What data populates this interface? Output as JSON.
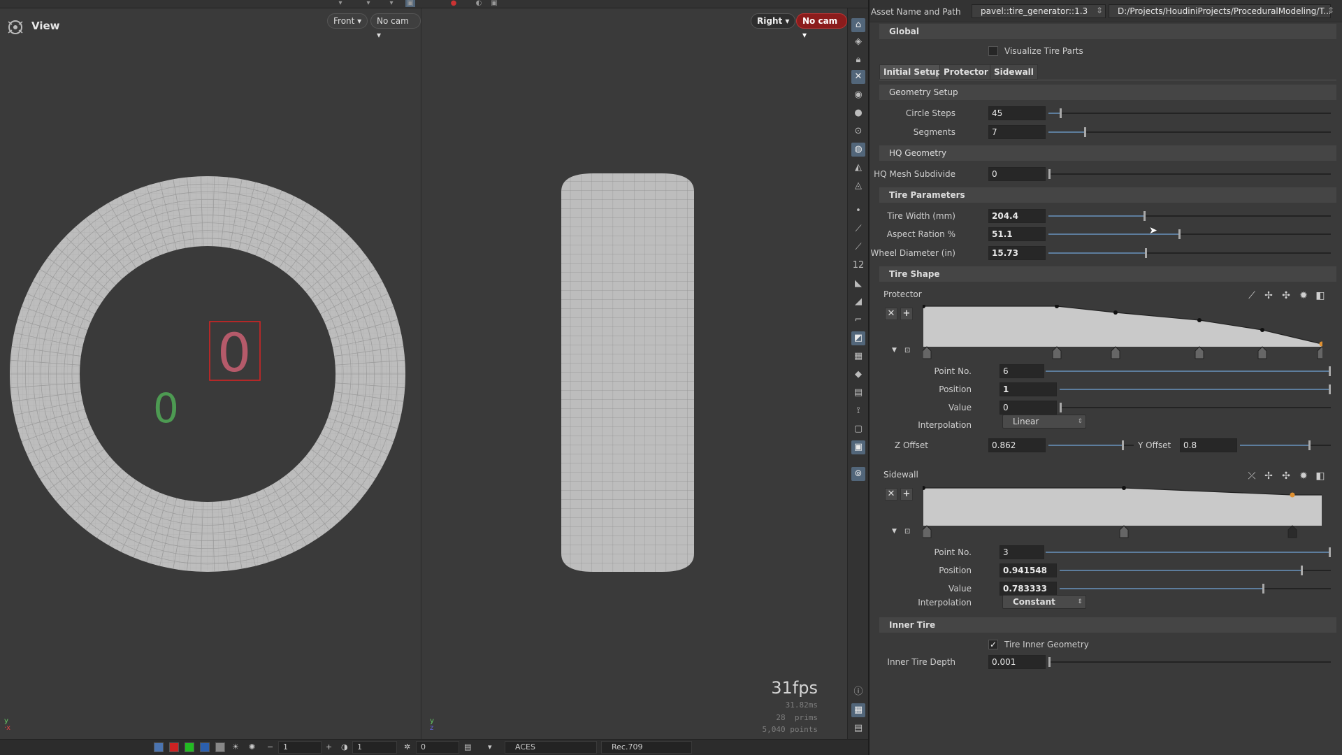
{
  "viewport": {
    "title": "View",
    "left_view": {
      "view_label": "Front",
      "cam_label": "No cam"
    },
    "right_view": {
      "view_label": "Right",
      "cam_label": "No cam"
    },
    "fps": "31fps",
    "frame_time": "31.82ms",
    "prims": "28  prims",
    "points": "5,040 points",
    "left_axis": "y\nx",
    "right_axis": "y\nz",
    "number_red": "0",
    "number_green": "0"
  },
  "bottombar": {
    "field1": "1",
    "field2": "1",
    "field3": "0",
    "colorspace": "ACES",
    "display": "Rec.709"
  },
  "panel": {
    "asset_label": "Asset Name and Path",
    "asset_name": "pavel::tire_generator::1.3",
    "asset_path": "D:/Projects/HoudiniProjects/ProceduralModeling/T...",
    "global": "Global",
    "visualize": "Visualize Tire Parts",
    "tabs": [
      "Initial Setup",
      "Protector",
      "Sidewall"
    ],
    "geometry_setup": "Geometry Setup",
    "circle_steps_label": "Circle Steps",
    "circle_steps": "45",
    "segments_label": "Segments",
    "segments": "7",
    "hq_geometry": "HQ Geometry",
    "hq_subdivide_label": "HQ Mesh Subdivide",
    "hq_subdivide": "0",
    "tire_params": "Tire Parameters",
    "tire_width_label": "Tire Width (mm)",
    "tire_width": "204.4",
    "aspect_label": "Aspect Ration %",
    "aspect": "51.1",
    "wheel_label": "Wheel Diameter (in)",
    "wheel": "15.73",
    "tire_shape": "Tire Shape",
    "protector": {
      "label": "Protector",
      "point_no_label": "Point No.",
      "point_no": "6",
      "position_label": "Position",
      "position": "1",
      "value_label": "Value",
      "value": "0",
      "interp_label": "Interpolation",
      "interp": "Linear",
      "zoffset_label": "Z Offset",
      "zoffset": "0.862",
      "yoffset_label": "Y Offset",
      "yoffset": "0.8"
    },
    "sidewall": {
      "label": "Sidewall",
      "point_no_label": "Point No.",
      "point_no": "3",
      "position_label": "Position",
      "position": "0.941548",
      "value_label": "Value",
      "value": "0.783333",
      "interp_label": "Interpolation",
      "interp": "Constant"
    },
    "inner_tire": "Inner Tire",
    "inner_geo": "Tire Inner Geometry",
    "inner_depth_label": "Inner Tire Depth",
    "inner_depth": "0.001"
  },
  "colors": {
    "accent": "#5d7d9d",
    "nocam_red": "#8b1c1c",
    "mesh": "#bdbdbd",
    "ramp": "#c9c9c9"
  }
}
